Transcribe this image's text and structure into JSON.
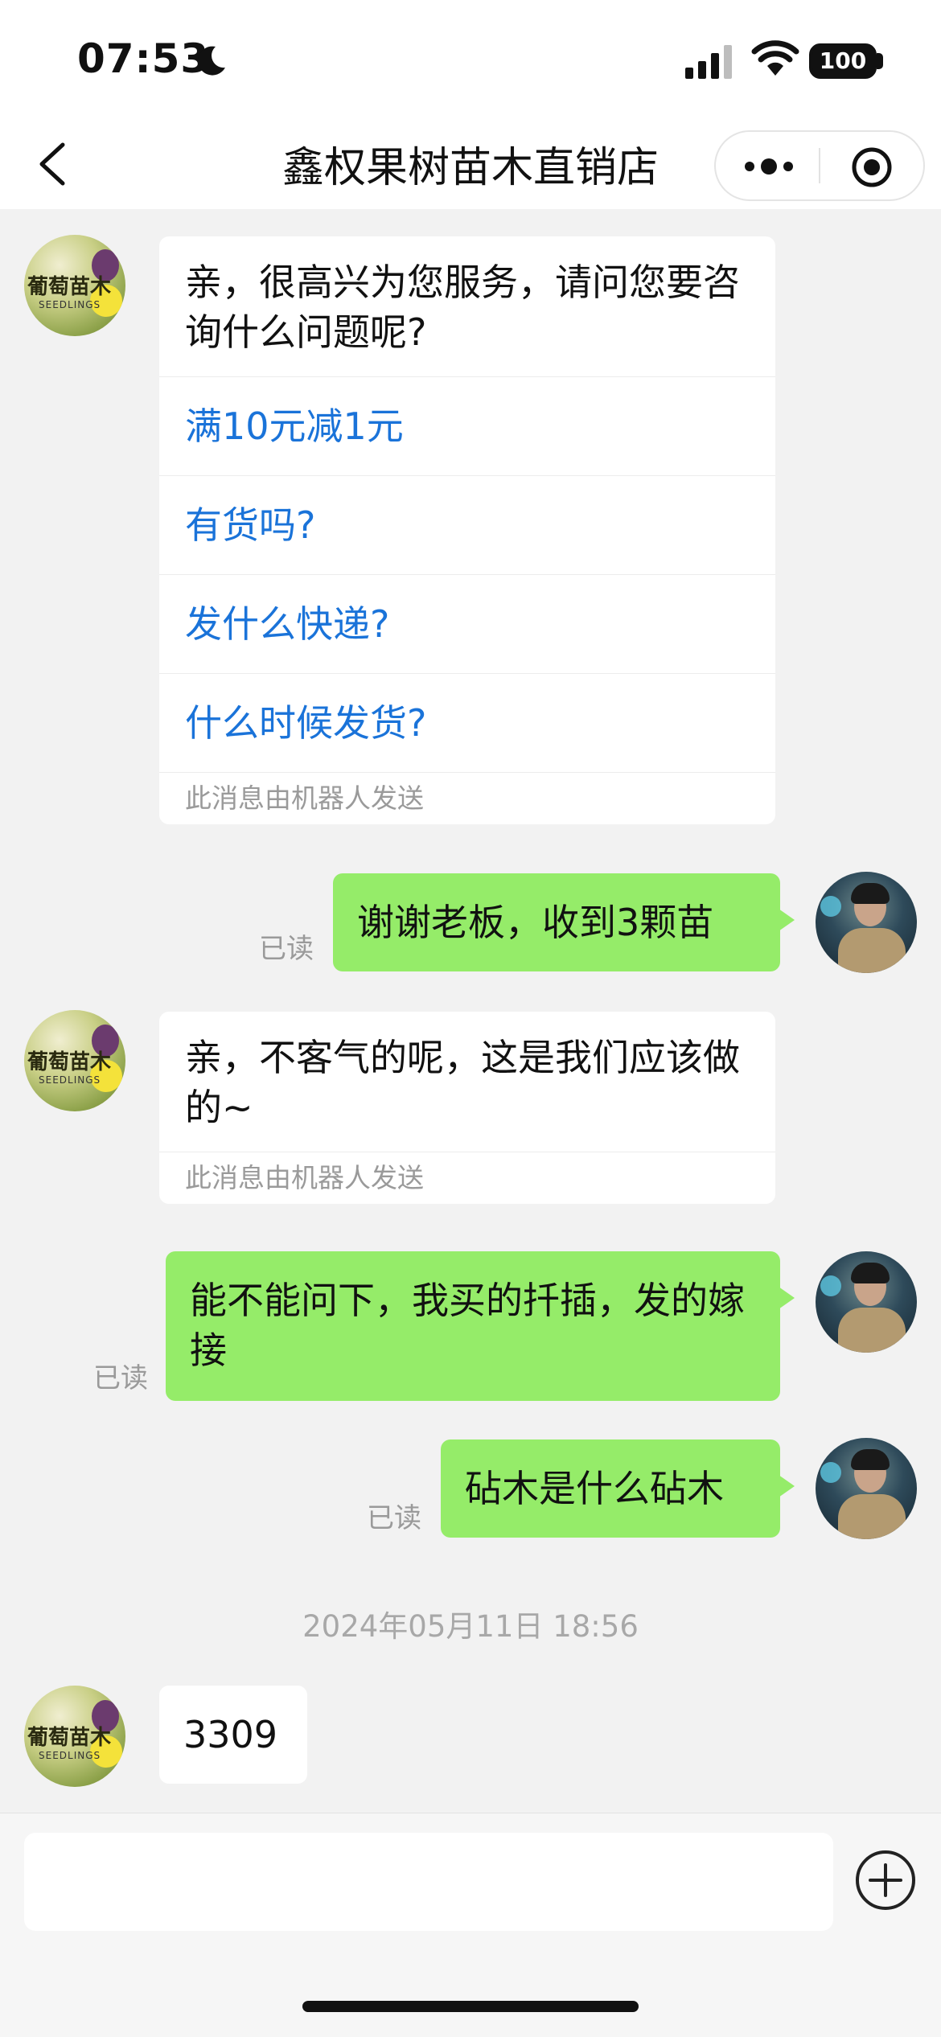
{
  "status_bar": {
    "time": "07:53",
    "battery": "100"
  },
  "nav": {
    "title": "鑫权果树苗木直销店"
  },
  "avatars": {
    "shop_logo_text": "葡萄苗木",
    "shop_logo_sub": "SEEDLINGS"
  },
  "messages": {
    "m1": {
      "text": "亲，很高兴为您服务，请问您要咨询什么问题呢?",
      "options": [
        "满10元减1元",
        "有货吗?",
        "发什么快递?",
        "什么时候发货?"
      ],
      "robot_note": "此消息由机器人发送"
    },
    "m2": {
      "text": "谢谢老板，收到3颗苗",
      "read": "已读"
    },
    "m3": {
      "text": "亲，不客气的呢，这是我们应该做的~",
      "robot_note": "此消息由机器人发送"
    },
    "m4": {
      "text": "能不能问下，我买的扦插，发的嫁接",
      "read": "已读"
    },
    "m5": {
      "text": "砧木是什么砧木",
      "read": "已读"
    },
    "timestamp": "2024年05月11日 18:56",
    "m6": {
      "text": "3309"
    }
  },
  "input": {
    "placeholder": ""
  },
  "colors": {
    "bubble_green": "#95ec69",
    "link_blue": "#1a73d9",
    "background": "#f2f2f2"
  }
}
